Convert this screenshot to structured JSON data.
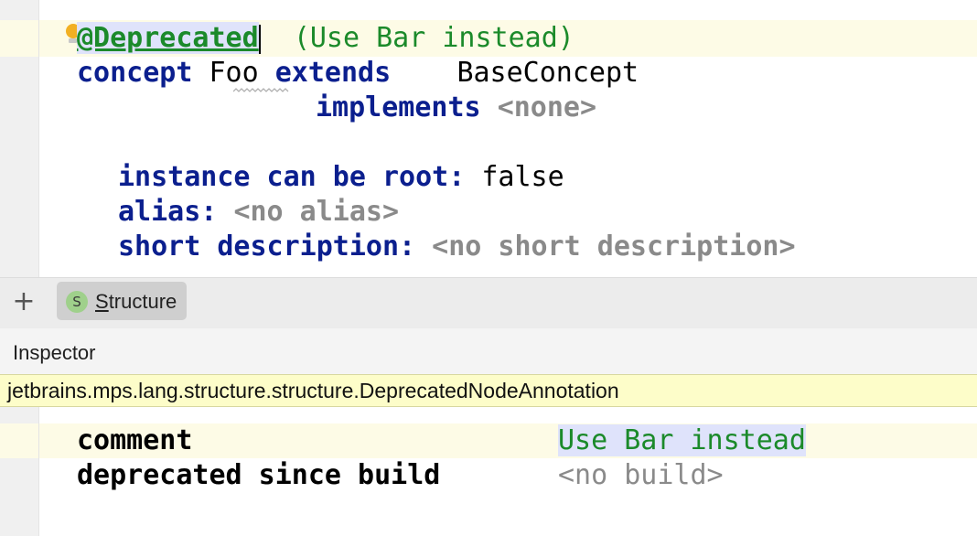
{
  "editor": {
    "annotation": "@Deprecated",
    "annotation_comment": "(Use Bar instead)",
    "kw_concept": "concept",
    "concept_name": "Foo",
    "kw_extends": "extends",
    "extends_value": "BaseConcept",
    "kw_implements": "implements",
    "implements_value": "<none>",
    "kw_instance_root": "instance can be root:",
    "instance_root_value": "false",
    "kw_alias": "alias:",
    "alias_value": "<no alias>",
    "kw_short_description": "short description:",
    "short_description_value": "<no short description>"
  },
  "toolbar": {
    "add_icon": "+",
    "tab_badge": "S",
    "tab_label_first": "S",
    "tab_label_rest": "tructure"
  },
  "inspector": {
    "title": "Inspector",
    "fqn": "jetbrains.mps.lang.structure.structure.DeprecatedNodeAnnotation",
    "comment_label": "comment",
    "comment_value": "Use Bar instead",
    "deprecated_since_label": "deprecated since build",
    "deprecated_since_value": "<no build>"
  },
  "colors": {
    "keyword": "#0b1f8e",
    "annotation": "#1b8a2a",
    "placeholder": "#8a8a8a",
    "current_line": "#fdfbe6",
    "selection": "#dfe3fb",
    "fqn_bar": "#fdfdc9"
  }
}
